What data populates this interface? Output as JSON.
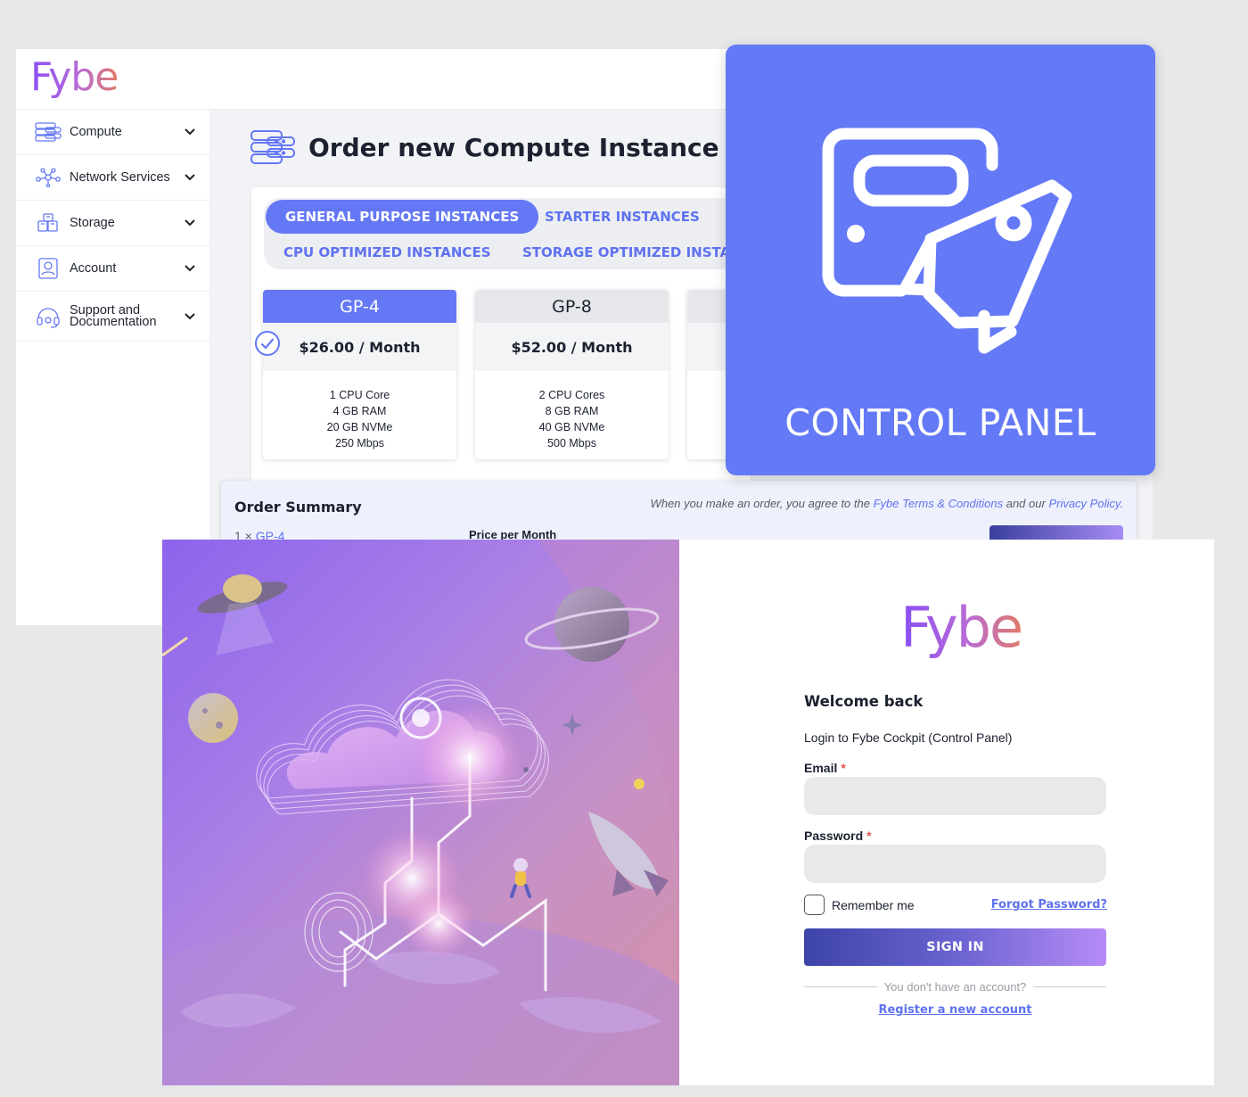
{
  "brand": {
    "name": "Fybe"
  },
  "sidebar": {
    "items": [
      {
        "label": "Compute",
        "icon": "server-stack-icon"
      },
      {
        "label": "Network Services",
        "icon": "network-nodes-icon"
      },
      {
        "label": "Storage",
        "icon": "storage-boxes-icon"
      },
      {
        "label": "Account",
        "icon": "account-id-icon"
      },
      {
        "label_line1": "Support and",
        "label_line2": "Documentation",
        "icon": "headset-icon"
      }
    ]
  },
  "order": {
    "title": "Order new Compute Instance",
    "tabs": [
      {
        "label": "GENERAL PURPOSE INSTANCES",
        "active": true
      },
      {
        "label": "STARTER INSTANCES",
        "active": false
      },
      {
        "label": "CPU OPTIMIZED INSTANCES",
        "active": false
      },
      {
        "label": "STORAGE OPTIMIZED INSTAN",
        "active": false
      }
    ],
    "plans": [
      {
        "name": "GP-4",
        "price": "$26.00 / Month",
        "specs": [
          "1 CPU Core",
          "4 GB RAM",
          "20 GB NVMe",
          "250 Mbps"
        ],
        "selected": true
      },
      {
        "name": "GP-8",
        "price": "$52.00 / Month",
        "specs": [
          "2 CPU Cores",
          "8 GB RAM",
          "40 GB NVMe",
          "500 Mbps"
        ],
        "selected": false
      }
    ]
  },
  "summary": {
    "title": "Order Summary",
    "terms_prefix": "When you make an order, you agree to the",
    "terms_link": "Fybe Terms & Conditions",
    "terms_middle": "and our",
    "privacy_link": "Privacy Policy.",
    "line_qty": "1 ×",
    "line_item": "GP-4",
    "col_price": "Price per Month"
  },
  "tile": {
    "label": "CONTROL PANEL",
    "icon": "server-rocket-icon",
    "color": "#6479f6"
  },
  "login": {
    "logo": "Fybe",
    "welcome": "Welcome back",
    "subtitle": "Login to Fybe Cockpit (Control Panel)",
    "email_label": "Email",
    "password_label": "Password",
    "required_mark": "*",
    "remember": "Remember me",
    "forgot": "Forgot Password?",
    "signin": "SIGN IN",
    "no_account": "You don't have an account?",
    "register": "Register a new account"
  },
  "colors": {
    "accent": "#6478f5",
    "brand_gradient_start": "#8a4ff5",
    "brand_gradient_end": "#e07a6a"
  }
}
